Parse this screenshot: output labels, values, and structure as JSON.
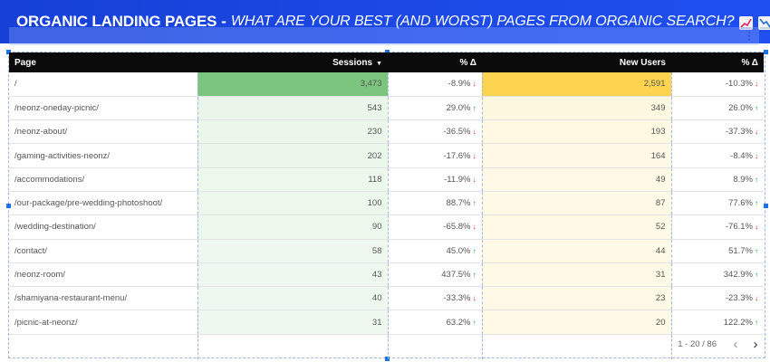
{
  "header": {
    "title_bold": "ORGANIC LANDING PAGES",
    "separator": "-",
    "title_italic": "WHAT ARE YOUR BEST (AND WORST) PAGES FROM ORGANIC SEARCH?"
  },
  "table": {
    "columns": {
      "page": "Page",
      "sessions": "Sessions",
      "sessions_delta": "% Δ",
      "new_users": "New Users",
      "new_users_delta": "% Δ"
    },
    "rows": [
      {
        "page": "/",
        "sessions": "3,473",
        "sessions_delta": "-8.9%",
        "sessions_dir": "down",
        "new_users": "2,591",
        "new_users_delta": "-10.3%",
        "new_users_dir": "down"
      },
      {
        "page": "/neonz-oneday-picnic/",
        "sessions": "543",
        "sessions_delta": "29.0%",
        "sessions_dir": "up",
        "new_users": "349",
        "new_users_delta": "26.0%",
        "new_users_dir": "up"
      },
      {
        "page": "/neonz-about/",
        "sessions": "230",
        "sessions_delta": "-36.5%",
        "sessions_dir": "down",
        "new_users": "193",
        "new_users_delta": "-37.3%",
        "new_users_dir": "down"
      },
      {
        "page": "/gaming-activities-neonz/",
        "sessions": "202",
        "sessions_delta": "-17.6%",
        "sessions_dir": "down",
        "new_users": "164",
        "new_users_delta": "-8.4%",
        "new_users_dir": "down"
      },
      {
        "page": "/accommodations/",
        "sessions": "118",
        "sessions_delta": "-11.9%",
        "sessions_dir": "down",
        "new_users": "49",
        "new_users_delta": "8.9%",
        "new_users_dir": "up"
      },
      {
        "page": "/our-package/pre-wedding-photoshoot/",
        "sessions": "100",
        "sessions_delta": "88.7%",
        "sessions_dir": "up",
        "new_users": "87",
        "new_users_delta": "77.6%",
        "new_users_dir": "up"
      },
      {
        "page": "/wedding-destination/",
        "sessions": "90",
        "sessions_delta": "-65.8%",
        "sessions_dir": "down",
        "new_users": "52",
        "new_users_delta": "-76.1%",
        "new_users_dir": "down"
      },
      {
        "page": "/contact/",
        "sessions": "58",
        "sessions_delta": "45.0%",
        "sessions_dir": "up",
        "new_users": "44",
        "new_users_delta": "51.7%",
        "new_users_dir": "up"
      },
      {
        "page": "/neonz-room/",
        "sessions": "43",
        "sessions_delta": "437.5%",
        "sessions_dir": "up",
        "new_users": "31",
        "new_users_delta": "342.9%",
        "new_users_dir": "up"
      },
      {
        "page": "/shamiyana-restaurant-menu/",
        "sessions": "40",
        "sessions_delta": "-33.3%",
        "sessions_dir": "down",
        "new_users": "23",
        "new_users_delta": "-23.3%",
        "new_users_dir": "down"
      },
      {
        "page": "/picnic-at-neonz/",
        "sessions": "31",
        "sessions_delta": "63.2%",
        "sessions_dir": "up",
        "new_users": "20",
        "new_users_delta": "122.2%",
        "new_users_dir": "up"
      }
    ],
    "pagination": "1 - 20 / 86"
  },
  "colors": {
    "banner": "#1c49e6",
    "sessions_heat_max": "#7cc57e",
    "sessions_heat_min": "#eef8ee",
    "new_users_heat_max": "#fdd450",
    "new_users_heat_min": "#fff9e6",
    "up": "#16a34a",
    "down": "#dc2626"
  },
  "icons": {
    "emoji_1": "chart-increasing-icon",
    "emoji_2": "chart-decreasing-icon",
    "sort": "caret-down-icon",
    "prev": "chevron-left-icon",
    "next": "chevron-right-icon",
    "menu": "kebab-menu-icon"
  }
}
